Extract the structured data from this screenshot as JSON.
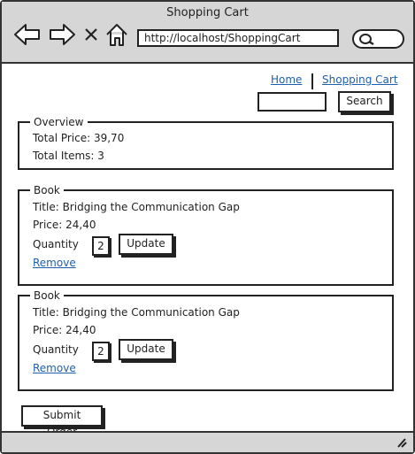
{
  "window": {
    "title": "Shopping Cart"
  },
  "browser": {
    "url": "http://localhost/ShoppingCart"
  },
  "nav": {
    "home": "Home",
    "shopping_cart": "Shopping Cart"
  },
  "search": {
    "button_label": "Search",
    "value": ""
  },
  "overview": {
    "legend": "Overview",
    "total_price": "Total Price: 39,70",
    "total_items": "Total Items: 3"
  },
  "books": [
    {
      "legend": "Book",
      "title": "Title: Bridging the Communication Gap",
      "price": "Price: 24,40",
      "quantity_label": "Quantity",
      "quantity": "2",
      "update_label": "Update",
      "remove_label": "Remove"
    },
    {
      "legend": "Book",
      "title": "Title: Bridging the Communication Gap",
      "price": "Price: 24,40",
      "quantity_label": "Quantity",
      "quantity": "2",
      "update_label": "Update",
      "remove_label": "Remove"
    }
  ],
  "submit_label": "Submit Order",
  "icons": {
    "back": "back-arrow-icon",
    "forward": "forward-arrow-icon",
    "close": "close-icon",
    "home": "home-icon",
    "search": "search-icon",
    "resize": "resize-grip-icon"
  },
  "colors": {
    "link": "#1f5fae",
    "chrome": "#d6d6d6"
  }
}
